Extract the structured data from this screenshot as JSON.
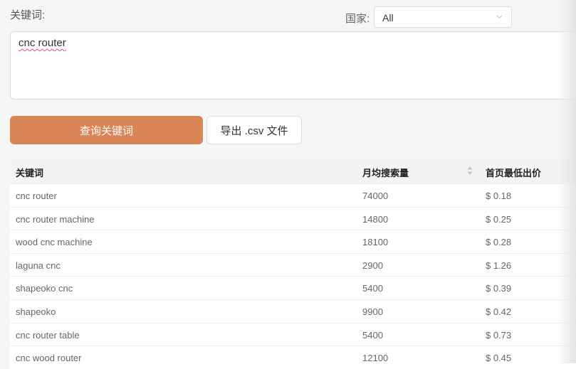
{
  "keywords_label": "关键词:",
  "country": {
    "label": "国家:",
    "selected": "All"
  },
  "keywords_input_value": "cnc router",
  "buttons": {
    "query": "查询关键词",
    "export": "导出 .csv 文件"
  },
  "table": {
    "headers": [
      "关键词",
      "月均搜索量",
      "首页最低出价"
    ],
    "rows": [
      [
        "cnc router",
        "74000",
        "$ 0.18"
      ],
      [
        "cnc router machine",
        "14800",
        "$ 0.25"
      ],
      [
        "wood cnc machine",
        "18100",
        "$ 0.28"
      ],
      [
        "laguna cnc",
        "2900",
        "$ 1.26"
      ],
      [
        "shapeoko cnc",
        "5400",
        "$ 0.39"
      ],
      [
        "shapeoko",
        "9900",
        "$ 0.42"
      ],
      [
        "cnc router table",
        "5400",
        "$ 0.73"
      ],
      [
        "cnc wood router",
        "12100",
        "$ 0.45"
      ]
    ]
  },
  "colors": {
    "primary_button": "#d98555",
    "background": "#f6f6f7"
  }
}
